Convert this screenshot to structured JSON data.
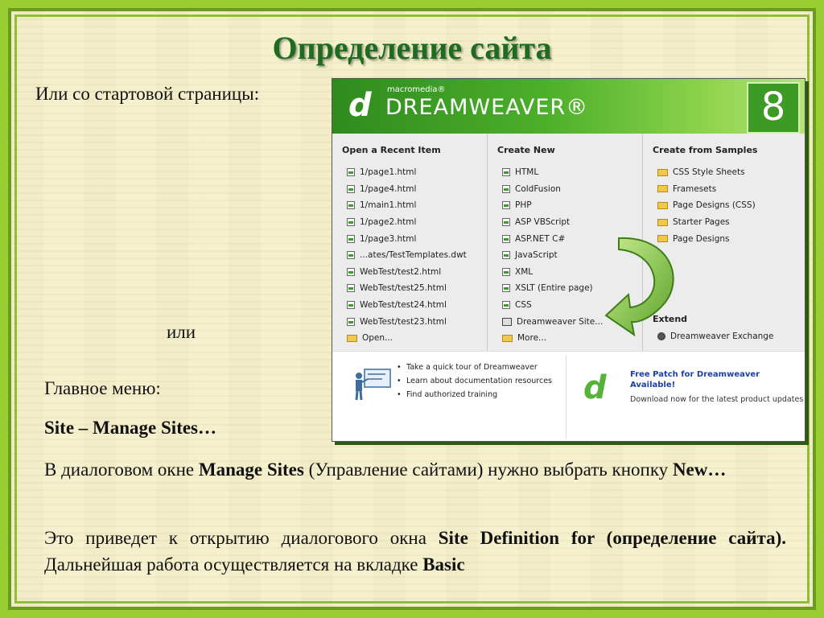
{
  "slide": {
    "title": "Определение сайта",
    "intro": "Или со стартовой страницы:",
    "or_text": "или",
    "main_menu": "Главное меню:",
    "menu_path": "Site – Manage Sites…",
    "para1": {
      "t1": "В диалоговом окне ",
      "b1": "Manage Sites",
      "t2": " (Управление сайтами) нужно выбрать кнопку ",
      "b2": "New…"
    },
    "para2": {
      "t1": "Это приведет к открытию диалогового окна ",
      "b1": "Site Definition for (определение сайта).",
      "t2": " Дальнейшая работа осуществляется на вкладке ",
      "b2": "Basic"
    }
  },
  "dreamweaver": {
    "logo_glyph": "d",
    "vendor": "macromedia®",
    "product": "DREAMWEAVER®",
    "version": "8",
    "open_recent": {
      "heading": "Open a Recent Item",
      "items": [
        "1/page1.html",
        "1/page4.html",
        "1/main1.html",
        "1/page2.html",
        "1/page3.html",
        "...ates/TestTemplates.dwt",
        "WebTest/test2.html",
        "WebTest/test25.html",
        "WebTest/test24.html",
        "WebTest/test23.html"
      ],
      "open_label": "Open..."
    },
    "create_new": {
      "heading": "Create New",
      "items": [
        "HTML",
        "ColdFusion",
        "PHP",
        "ASP VBScript",
        "ASP.NET C#",
        "JavaScript",
        "XML",
        "XSLT (Entire page)",
        "CSS"
      ],
      "site_label": "Dreamweaver Site...",
      "more_label": "More..."
    },
    "create_samples": {
      "heading": "Create from Samples",
      "items": [
        "CSS Style Sheets",
        "Framesets",
        "Page Designs (CSS)",
        "Starter Pages",
        "Page Designs"
      ]
    },
    "extend": {
      "heading": "Extend",
      "exchange_label": "Dreamweaver Exchange"
    },
    "footer": {
      "tour": "Take a quick tour of Dreamweaver",
      "docs": "Learn about documentation resources",
      "training": "Find authorized training",
      "patch_title": "Free Patch for Dreamweaver Available!",
      "patch_sub": "Download now for the latest product updates"
    }
  }
}
